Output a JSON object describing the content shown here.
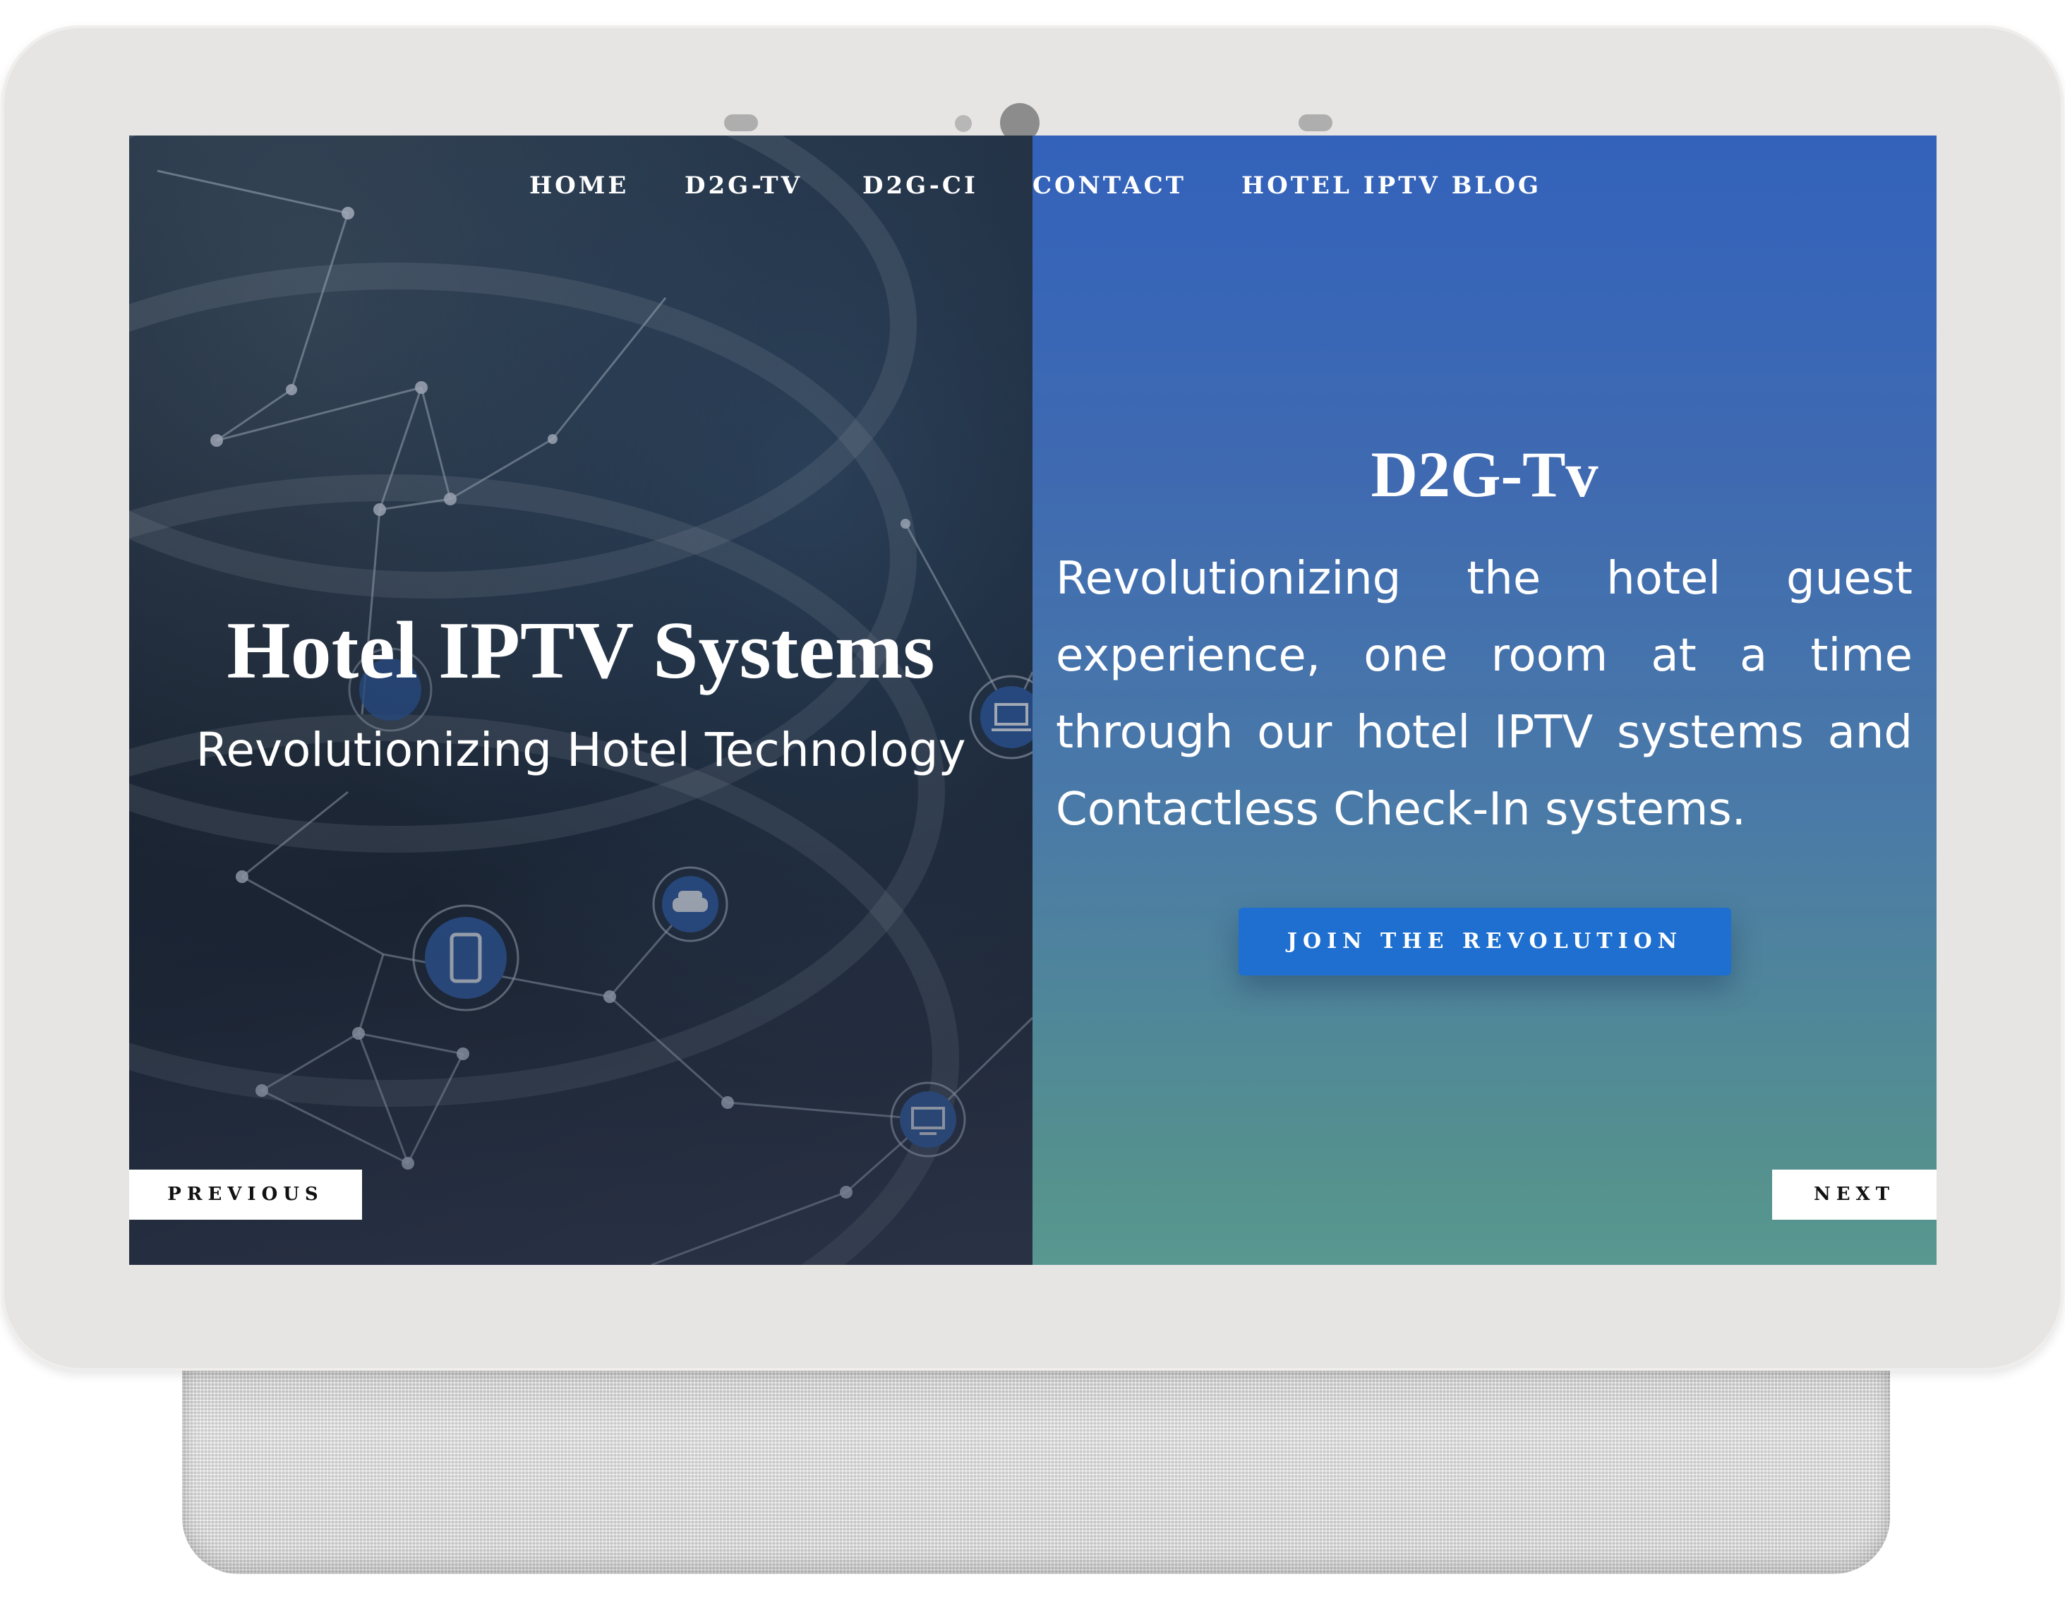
{
  "nav": {
    "items": [
      {
        "label": "HOME"
      },
      {
        "label": "D2G-TV"
      },
      {
        "label": "D2G-CI"
      },
      {
        "label": "CONTACT"
      },
      {
        "label": "HOTEL IPTV BLOG"
      }
    ]
  },
  "hero": {
    "title": "Hotel IPTV Systems",
    "subtitle": "Revolutionizing Hotel Technology"
  },
  "product": {
    "title": "D2G-Tv",
    "description": "Revolutionizing the hotel guest experience, one room at a time through our hotel IPTV systems and Contactless Check-In systems.",
    "cta_label": "JOIN THE REVOLUTION"
  },
  "slider": {
    "previous_label": "PREVIOUS",
    "next_label": "NEXT"
  },
  "icons": {
    "network_nodes": [
      "tablet-icon",
      "car-icon",
      "monitor-icon",
      "desktop-icon",
      "laptop-icon"
    ]
  },
  "colors": {
    "right_panel_top": "#3362bb",
    "right_panel_bottom": "#589890",
    "cta_background": "#1e6fcf",
    "device_frame": "#e7e5e4"
  }
}
